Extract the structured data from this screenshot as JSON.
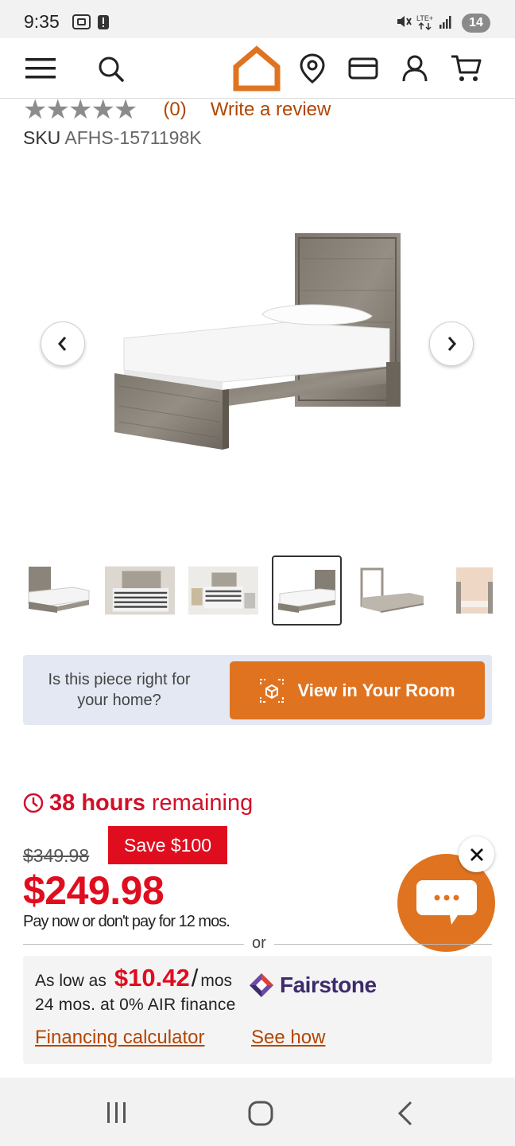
{
  "status_bar": {
    "time": "9:35",
    "battery": "14",
    "icons": [
      "screenshot-icon",
      "alert-icon",
      "mute-icon",
      "lte-signal-icon",
      "signal-bars-icon"
    ]
  },
  "nav": {
    "icons": [
      "menu-icon",
      "search-icon",
      "home-logo-icon",
      "location-pin-icon",
      "credit-card-icon",
      "account-icon",
      "cart-icon"
    ],
    "brand_color": "#e07320"
  },
  "product": {
    "rating_stars": "★★★★★",
    "review_count": "(0)",
    "write_review": "Write a review",
    "sku_label": "SKU",
    "sku_value": "AFHS-1571198K",
    "gallery_selected_index": 3
  },
  "ar_banner": {
    "question": "Is this piece right for your home?",
    "button_label": "View in Your Room"
  },
  "deal": {
    "timer_strong": "38 hours",
    "timer_rest": "remaining",
    "original_price": "$349.98",
    "save_badge": "Save $100",
    "price": "$249.98",
    "pay_note": "Pay now or don't pay for 12 mos."
  },
  "financing": {
    "or_text": "or",
    "as_low_as": "As low as",
    "monthly_amount": "$10.42",
    "slash": "/",
    "per": "mos",
    "terms": "24 mos. at 0% AIR finance",
    "provider": "Fairstone",
    "calculator_link": "Financing calculator",
    "see_how_link": "See how"
  },
  "colors": {
    "accent": "#e07320",
    "sale_red": "#e00d1f",
    "link": "#b34500"
  }
}
